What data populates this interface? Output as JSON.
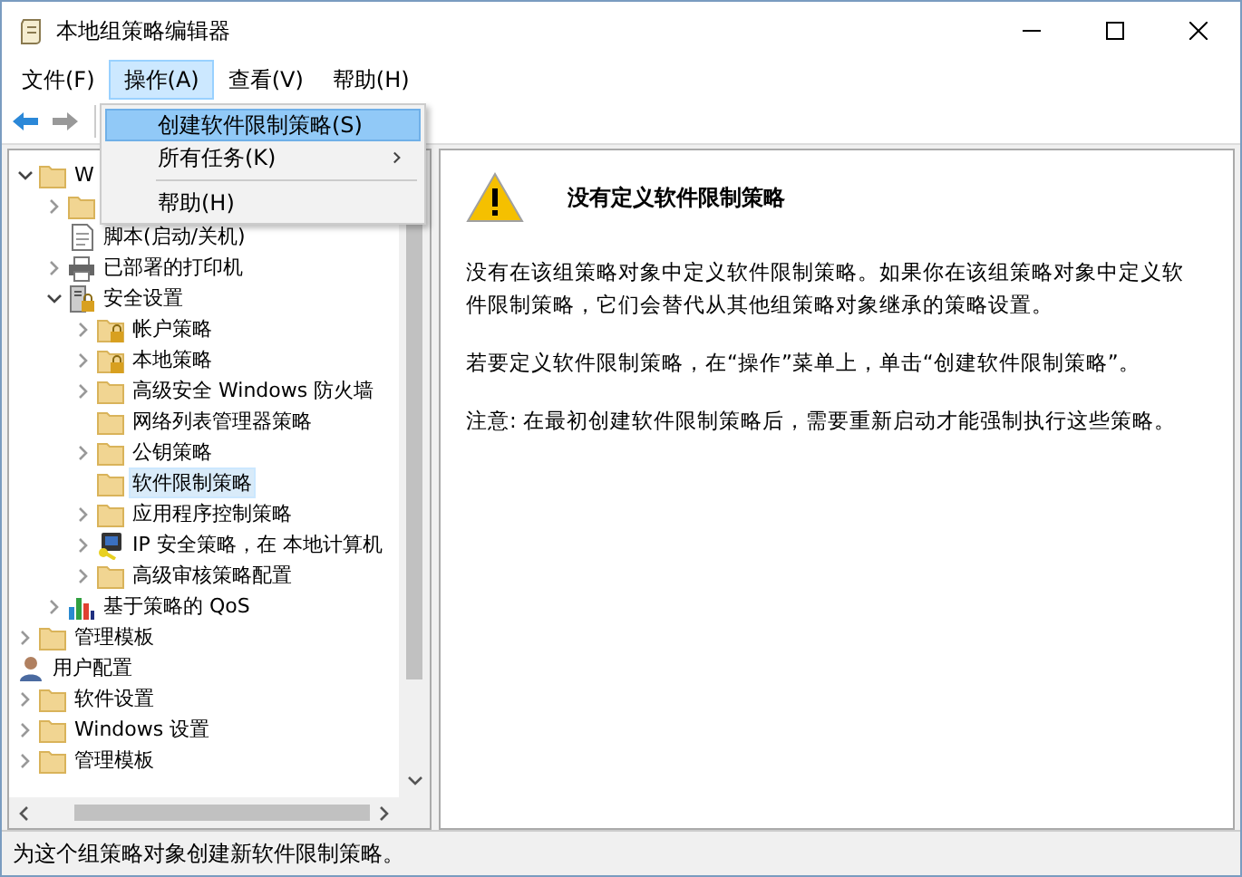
{
  "window": {
    "title": "本地组策略编辑器"
  },
  "menu_bar": [
    {
      "label": "文件(F)",
      "selected": false
    },
    {
      "label": "操作(A)",
      "selected": true
    },
    {
      "label": "查看(V)",
      "selected": false
    },
    {
      "label": "帮助(H)",
      "selected": false
    }
  ],
  "toolbar": {
    "back_disabled": false,
    "forward_disabled": true
  },
  "dropdown": [
    {
      "kind": "item",
      "label": "创建软件限制策略(S)",
      "selected": true,
      "submenu": false
    },
    {
      "kind": "item",
      "label": "所有任务(K)",
      "selected": false,
      "submenu": true
    },
    {
      "kind": "separator"
    },
    {
      "kind": "item",
      "label": "帮助(H)",
      "selected": false,
      "submenu": false
    }
  ],
  "tree": [
    {
      "label": "W",
      "kind": "folder",
      "expanded": true,
      "selected": false,
      "children": [
        {
          "kind": "folder",
          "expanded": false
        },
        {
          "label": "脚本(启动/关机)",
          "kind": "script",
          "selected": false
        },
        {
          "label": "已部署的打印机",
          "kind": "printer",
          "expanded": false,
          "selected": false
        },
        {
          "label": "安全设置",
          "kind": "security",
          "expanded": true,
          "selected": false,
          "children": [
            {
              "label": "帐户策略",
              "kind": "folder-lock",
              "expanded": false,
              "selected": false
            },
            {
              "label": "本地策略",
              "kind": "folder-lock",
              "expanded": false,
              "selected": false
            },
            {
              "label": "高级安全 Windows 防火墙",
              "kind": "folder",
              "expanded": false,
              "selected": false
            },
            {
              "label": "网络列表管理器策略",
              "kind": "folder",
              "selected": false
            },
            {
              "label": "公钥策略",
              "kind": "folder",
              "expanded": false,
              "selected": false
            },
            {
              "label": "软件限制策略",
              "kind": "folder",
              "selected": true
            },
            {
              "label": "应用程序控制策略",
              "kind": "folder",
              "expanded": false,
              "selected": false
            },
            {
              "label": "IP 安全策略，在 本地计算机",
              "kind": "ipsec",
              "expanded": false,
              "selected": false
            },
            {
              "label": "高级审核策略配置",
              "kind": "folder",
              "expanded": false,
              "selected": false
            }
          ]
        },
        {
          "label": "基于策略的 QoS",
          "kind": "chart",
          "expanded": false,
          "selected": false
        }
      ]
    },
    {
      "label": "管理模板",
      "kind": "folder",
      "expanded": false,
      "selected": false
    },
    {
      "label": "用户配置",
      "kind": "user",
      "selected": false,
      "children": [
        {
          "label": "软件设置",
          "kind": "folder",
          "expanded": false,
          "selected": false
        },
        {
          "label": "Windows 设置",
          "kind": "folder",
          "expanded": false,
          "selected": false
        },
        {
          "label": "管理模板",
          "kind": "folder",
          "expanded": false,
          "selected": false
        }
      ]
    }
  ],
  "detail": {
    "heading": "没有定义软件限制策略",
    "paragraphs": [
      "没有在该组策略对象中定义软件限制策略。如果你在该组策略对象中定义软件限制策略，它们会替代从其他组策略对象继承的策略设置。",
      "若要定义软件限制策略，在“操作”菜单上，单击“创建软件限制策略”。",
      "注意: 在最初创建软件限制策略后，需要重新启动才能强制执行这些策略。"
    ]
  },
  "status_bar": "为这个组策略对象创建新软件限制策略。"
}
